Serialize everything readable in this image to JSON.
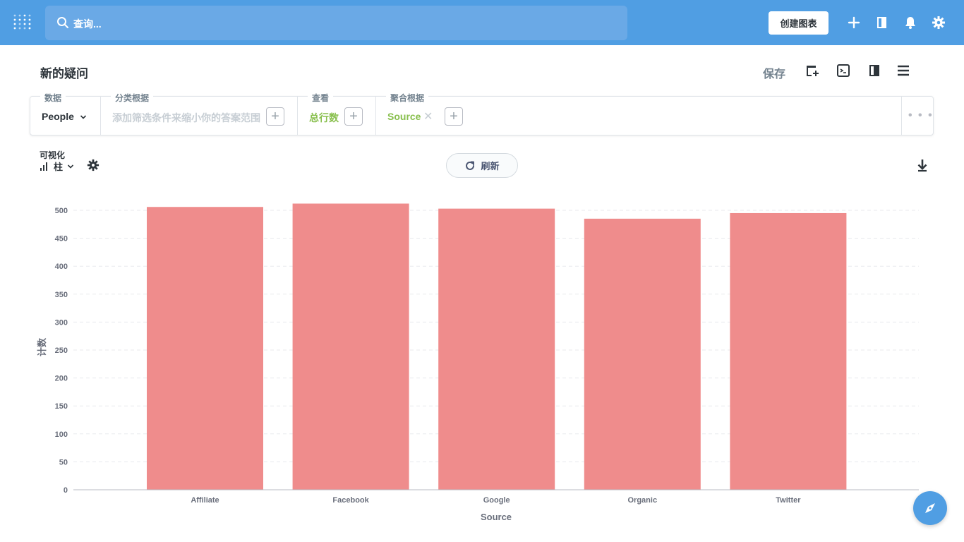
{
  "topbar": {
    "search_placeholder": "查询...",
    "create_chart_label": "创建图表"
  },
  "header": {
    "title": "新的疑问",
    "save_label": "保存"
  },
  "builder": {
    "data_label": "数据",
    "data_value": "People",
    "filter_label": "分类根据",
    "filter_placeholder": "添加筛选条件来缩小你的答案范围",
    "view_label": "查看",
    "view_value": "总行数",
    "group_label": "聚合根据",
    "group_value": "Source",
    "remove_symbol": "✕",
    "add_symbol": "+",
    "more_symbol": "• • •"
  },
  "viz": {
    "label": "可视化",
    "type_label": "柱",
    "refresh_label": "刷新"
  },
  "colors": {
    "brand": "#509ee3",
    "bar": "#ef8c8c",
    "filter_green": "#88bf4d"
  },
  "chart_data": {
    "type": "bar",
    "categories": [
      "Affiliate",
      "Facebook",
      "Google",
      "Organic",
      "Twitter"
    ],
    "values": [
      506,
      512,
      503,
      485,
      495
    ],
    "xlabel": "Source",
    "ylabel": "计数",
    "ylim": [
      0,
      500
    ],
    "yticks": [
      0,
      50,
      100,
      150,
      200,
      250,
      300,
      350,
      400,
      450,
      500
    ],
    "grid": true
  }
}
